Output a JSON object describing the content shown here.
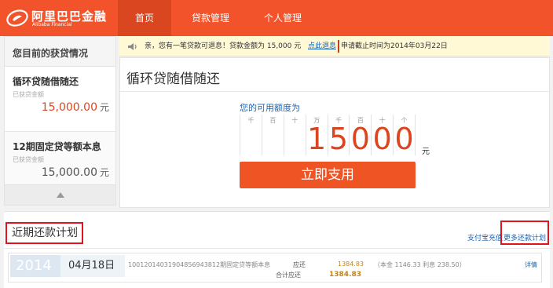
{
  "brand": {
    "name_cn": "阿里巴巴金融",
    "name_en": "Alibaba Financial"
  },
  "nav": {
    "items": [
      "首页",
      "贷款管理",
      "个人管理"
    ],
    "active": "首页"
  },
  "sidebar": {
    "heading": "您目前的获贷情况",
    "loans": [
      {
        "title": "循环贷随借随还",
        "sub": "已获贷金额",
        "amount": "15,000.00",
        "unit": "元"
      },
      {
        "title": "12期固定贷等额本息",
        "sub": "已获贷金额",
        "amount": "15,000.00",
        "unit": "元"
      }
    ]
  },
  "notice": {
    "message": "亲，您有一笔贷款可退息！贷款金额为 15,000 元",
    "link": "点此退息",
    "deadline": "申请截止时间为2014年03月22日"
  },
  "main": {
    "title": "循环贷随借随还",
    "available_label": "您的可用额度为",
    "unit_labels": [
      "千",
      "百",
      "十",
      "万",
      "千",
      "百",
      "十",
      "个"
    ],
    "digits": [
      "",
      "",
      "",
      "1",
      "5",
      "0",
      "0",
      "0"
    ],
    "amount_unit": "元",
    "pay_button": "立即支用"
  },
  "plans": {
    "title": "近期还款计划",
    "link_recharge": "支付宝充值",
    "link_more": "更多还款计划",
    "rows": [
      {
        "year": "2014",
        "date": "04月18日",
        "loan_id": "10012014031904856943812期固定贷等额本息",
        "due_label": "应还",
        "due_amount": "1384.83",
        "detail": "（本金 1146.33   利息 238.50）",
        "total_label": "合计应还",
        "total_amount": "1384.83",
        "link": "详情"
      }
    ]
  },
  "colors": {
    "brand": "#f2532a",
    "accent": "#d9461f",
    "link": "#1a64b4",
    "highlight_box": "#e0141e"
  }
}
